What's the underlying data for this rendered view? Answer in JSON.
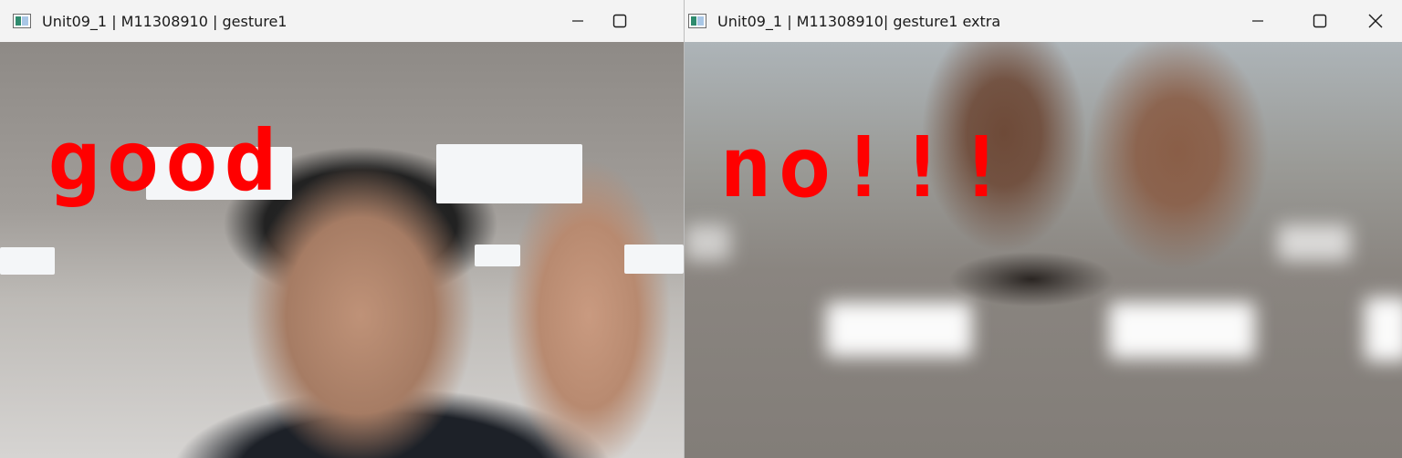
{
  "windows": [
    {
      "title": "Unit09_1 | M11308910 | gesture1",
      "overlay_text": "good",
      "overlay_color": "#ff0000",
      "controls": [
        "minimize",
        "maximize"
      ]
    },
    {
      "title": "Unit09_1 | M11308910| gesture1 extra",
      "overlay_text": "no!!!",
      "overlay_color": "#ff0000",
      "controls": [
        "minimize",
        "maximize",
        "close"
      ]
    }
  ]
}
